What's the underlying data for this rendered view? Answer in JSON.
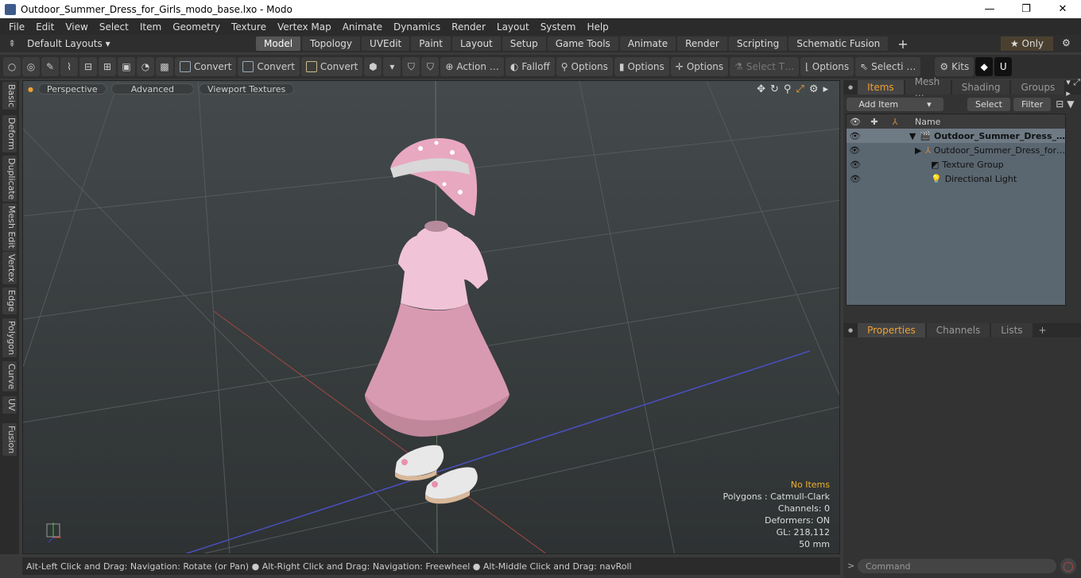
{
  "window": {
    "title": "Outdoor_Summer_Dress_for_Girls_modo_base.lxo - Modo",
    "minimize": "—",
    "maximize": "❐",
    "close": "✕"
  },
  "menu": [
    "File",
    "Edit",
    "View",
    "Select",
    "Item",
    "Geometry",
    "Texture",
    "Vertex Map",
    "Animate",
    "Dynamics",
    "Render",
    "Layout",
    "System",
    "Help"
  ],
  "layout": {
    "default_layouts": "Default Layouts ▾",
    "tabs": [
      "Model",
      "Topology",
      "UVEdit",
      "Paint",
      "Layout",
      "Setup",
      "Game Tools",
      "Animate",
      "Render",
      "Scripting",
      "Schematic Fusion"
    ],
    "active_tab": "Model",
    "plus": "+",
    "only": "★ Only",
    "gear": "⚙"
  },
  "toolbar": {
    "convert1": "Convert",
    "convert2": "Convert",
    "convert3": "Convert",
    "action": "Action …",
    "falloff": "Falloff",
    "options1": "Options",
    "options2": "Options",
    "options3": "Options",
    "select_t": "Select T…",
    "options4": "Options",
    "selecti": "Selecti …",
    "kits": "Kits"
  },
  "left_tabs": [
    "Basic",
    "Deform",
    "Duplicate",
    "Mesh Edit",
    "Vertex",
    "Edge",
    "Polygon",
    "Curve",
    "UV",
    "Fusion"
  ],
  "viewport": {
    "perspective": "Perspective",
    "advanced": "Advanced",
    "viewport_textures": "Viewport Textures",
    "stats": {
      "no_items": "No Items",
      "polygons": "Polygons : Catmull-Clark",
      "channels": "Channels: 0",
      "deformers": "Deformers: ON",
      "gl": "GL: 218,112",
      "mm": "50 mm"
    }
  },
  "status": "Alt-Left Click and Drag: Navigation: Rotate (or Pan) ● Alt-Right Click and Drag: Navigation: Freewheel ● Alt-Middle Click and Drag: navRoll",
  "items_panel": {
    "tabs": [
      "Items",
      "Mesh …",
      "Shading",
      "Groups"
    ],
    "add_item": "Add Item",
    "select": "Select",
    "filter": "Filter",
    "name_col": "Name",
    "rows": [
      "Outdoor_Summer_Dress_…",
      "Outdoor_Summer_Dress_for…",
      "Texture Group",
      "Directional Light"
    ]
  },
  "props_panel": {
    "tabs": [
      "Properties",
      "Channels",
      "Lists"
    ],
    "plus": "+"
  },
  "command_placeholder": "Command"
}
